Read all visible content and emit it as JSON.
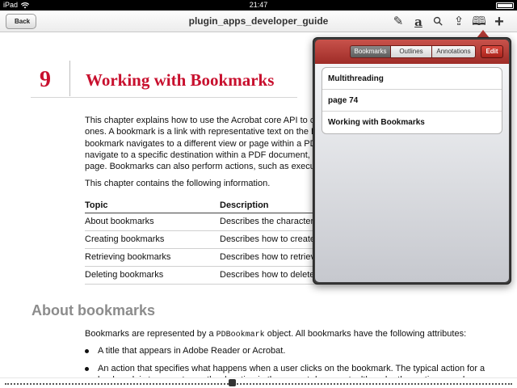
{
  "status_bar": {
    "carrier": "iPad",
    "time": "21:47",
    "battery_level": 1.0
  },
  "toolbar": {
    "back_label": "Back",
    "title": "plugin_apps_developer_guide",
    "icons": [
      "pencil-icon",
      "text-a-icon",
      "search-icon",
      "share-icon",
      "book-icon",
      "plus-icon"
    ],
    "icon_glyphs": {
      "pencil": "✎",
      "text": "a",
      "search": "⚲",
      "share": "⇪",
      "book": "🕮",
      "plus": "+"
    }
  },
  "document": {
    "chapter_number": "9",
    "chapter_title": "Working with Bookmarks",
    "intro_lines": [
      "This chapter explains how to use the Acrobat core API to crea",
      "ones. A bookmark is a link with representative text on the Bo",
      "bookmark navigates to a different view or page within a PDF",
      "navigate to a specific destination within a PDF document, to",
      "page. Bookmarks can also perform actions, such as executin"
    ],
    "contains_text": "This chapter contains the following information.",
    "table": {
      "headers": [
        "Topic",
        "Description"
      ],
      "rows": [
        [
          "About bookmarks",
          "Describes the characteris"
        ],
        [
          "Creating bookmarks",
          "Describes how to create a"
        ],
        [
          "Retrieving bookmarks",
          "Describes how to retrieve"
        ],
        [
          "Deleting bookmarks",
          "Describes how to delete"
        ]
      ]
    },
    "section_heading": "About bookmarks",
    "attr_intro_before": "Bookmarks are represented by a ",
    "attr_intro_code": "PDBookmark",
    "attr_intro_after": " object. All bookmarks have the following attributes:",
    "bullets": [
      "A title that appears in Adobe Reader or Acrobat.",
      "An action that specifies what happens when a user clicks on the bookmark. The typical action for a bookmark is to move to another location in the current document, although other actions can be specified."
    ]
  },
  "popover": {
    "tabs": [
      "Bookmarks",
      "Outlines",
      "Annotations"
    ],
    "active_tab": "Bookmarks",
    "edit_label": "Edit",
    "bookmarks": [
      "Multithreading",
      "page 74",
      "Working with Bookmarks"
    ]
  },
  "colors": {
    "chapter_red": "#c8102e",
    "popover_header": "#b13a35"
  }
}
